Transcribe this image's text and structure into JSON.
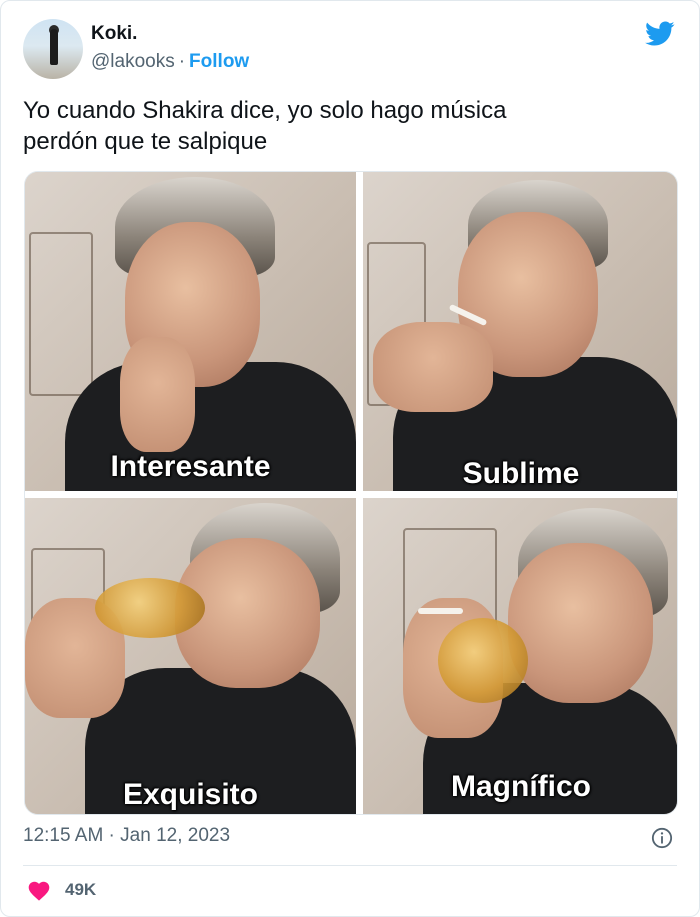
{
  "user": {
    "name": "Koki.",
    "handle": "@lakooks",
    "separator": "·",
    "follow_label": "Follow"
  },
  "tweet": {
    "text": "Yo cuando Shakira dice, yo solo hago música\nperdón que te salpique"
  },
  "media": {
    "panels": [
      {
        "caption": "Interesante"
      },
      {
        "caption": "Sublime"
      },
      {
        "caption": "Exquisito"
      },
      {
        "caption": "Magnífico"
      }
    ]
  },
  "meta": {
    "timestamp": "12:15 AM · Jan 12, 2023"
  },
  "engagement": {
    "likes": "49K"
  },
  "colors": {
    "brand_blue": "#1d9bf0",
    "like_red": "#f91880",
    "muted_text": "#536471"
  },
  "icons": {
    "platform": "twitter-bird-icon",
    "info": "info-icon",
    "like": "heart-icon"
  }
}
